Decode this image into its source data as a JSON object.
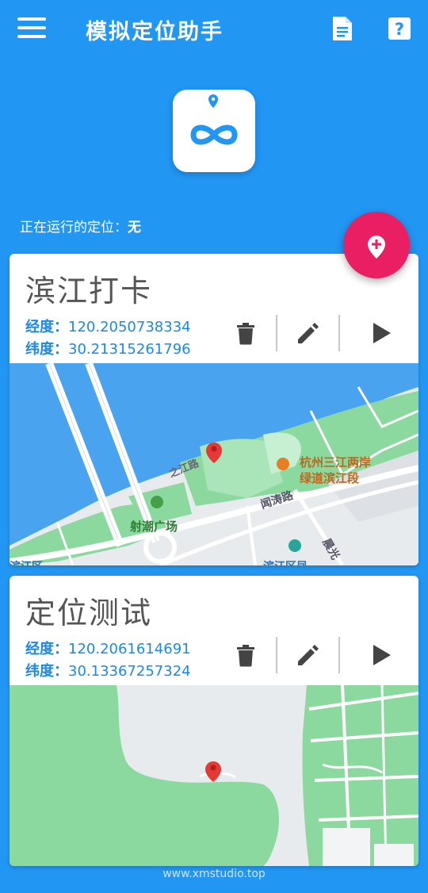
{
  "header": {
    "title": "模拟定位助手",
    "menu_icon": "menu-icon",
    "doc_icon": "document-icon",
    "help_icon": "help-icon"
  },
  "app_icon": "infinity-location-icon",
  "status": {
    "label": "正在运行的定位：",
    "value": "无"
  },
  "fab_icon": "add-location-icon",
  "colors": {
    "primary": "#2196F3",
    "accent": "#E91E63",
    "coord_text": "#1E88E5",
    "map_water": "#4AA3EE",
    "map_park": "#8BD99F",
    "map_land": "#E8EBEE"
  },
  "locations": [
    {
      "name": "滨江打卡",
      "lng_label": "经度：",
      "lng": "120.2050738334",
      "lat_label": "纬度：",
      "lat": "30.21315261796",
      "map_labels": {
        "poi1": "杭州三江两岸",
        "poi1b": "绿道滨江段",
        "square": "射潮广场",
        "road1": "之江路",
        "road2": "闻涛路",
        "road3": "晨光",
        "partial_bottom": "滨江区凤",
        "partial_left": "滨江区"
      }
    },
    {
      "name": "定位测试",
      "lng_label": "经度：",
      "lng": "120.2061614691",
      "lat_label": "纬度：",
      "lat": "30.13367257324"
    }
  ],
  "footer": "www.xmstudio.top"
}
